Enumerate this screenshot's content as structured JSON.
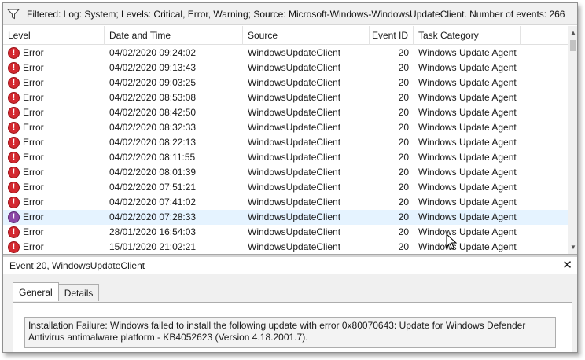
{
  "filter": {
    "text": "Filtered: Log: System; Levels: Critical, Error, Warning; Source: Microsoft-Windows-WindowsUpdateClient. Number of events: 266",
    "icon": "funnel-filter-icon"
  },
  "columns": {
    "level": "Level",
    "date": "Date and Time",
    "source": "Source",
    "event_id": "Event ID",
    "category": "Task Category"
  },
  "rows": [
    {
      "level": "Error",
      "date": "04/02/2020 09:24:02",
      "source": "WindowsUpdateClient",
      "event_id": "20",
      "category": "Windows Update Agent"
    },
    {
      "level": "Error",
      "date": "04/02/2020 09:13:43",
      "source": "WindowsUpdateClient",
      "event_id": "20",
      "category": "Windows Update Agent"
    },
    {
      "level": "Error",
      "date": "04/02/2020 09:03:25",
      "source": "WindowsUpdateClient",
      "event_id": "20",
      "category": "Windows Update Agent"
    },
    {
      "level": "Error",
      "date": "04/02/2020 08:53:08",
      "source": "WindowsUpdateClient",
      "event_id": "20",
      "category": "Windows Update Agent"
    },
    {
      "level": "Error",
      "date": "04/02/2020 08:42:50",
      "source": "WindowsUpdateClient",
      "event_id": "20",
      "category": "Windows Update Agent"
    },
    {
      "level": "Error",
      "date": "04/02/2020 08:32:33",
      "source": "WindowsUpdateClient",
      "event_id": "20",
      "category": "Windows Update Agent"
    },
    {
      "level": "Error",
      "date": "04/02/2020 08:22:13",
      "source": "WindowsUpdateClient",
      "event_id": "20",
      "category": "Windows Update Agent"
    },
    {
      "level": "Error",
      "date": "04/02/2020 08:11:55",
      "source": "WindowsUpdateClient",
      "event_id": "20",
      "category": "Windows Update Agent"
    },
    {
      "level": "Error",
      "date": "04/02/2020 08:01:39",
      "source": "WindowsUpdateClient",
      "event_id": "20",
      "category": "Windows Update Agent"
    },
    {
      "level": "Error",
      "date": "04/02/2020 07:51:21",
      "source": "WindowsUpdateClient",
      "event_id": "20",
      "category": "Windows Update Agent"
    },
    {
      "level": "Error",
      "date": "04/02/2020 07:41:02",
      "source": "WindowsUpdateClient",
      "event_id": "20",
      "category": "Windows Update Agent"
    },
    {
      "level": "Error",
      "date": "04/02/2020 07:28:33",
      "source": "WindowsUpdateClient",
      "event_id": "20",
      "category": "Windows Update Agent"
    },
    {
      "level": "Error",
      "date": "28/01/2020 16:54:03",
      "source": "WindowsUpdateClient",
      "event_id": "20",
      "category": "Windows Update Agent"
    },
    {
      "level": "Error",
      "date": "15/01/2020 21:02:21",
      "source": "WindowsUpdateClient",
      "event_id": "20",
      "category": "Windows Update Agent"
    }
  ],
  "detail": {
    "title": "Event 20, WindowsUpdateClient",
    "close": "✕",
    "tabs": [
      "General",
      "Details"
    ],
    "message": "Installation Failure: Windows failed to install the following update with error 0x80070643: Update for Windows Defender Antivirus antimalware platform - KB4052623 (Version 4.18.2001.7)."
  },
  "colors": {
    "error_red": "#d3282f",
    "hover_row": "#e5f3ff",
    "panel_gray": "#f0f0f0"
  }
}
